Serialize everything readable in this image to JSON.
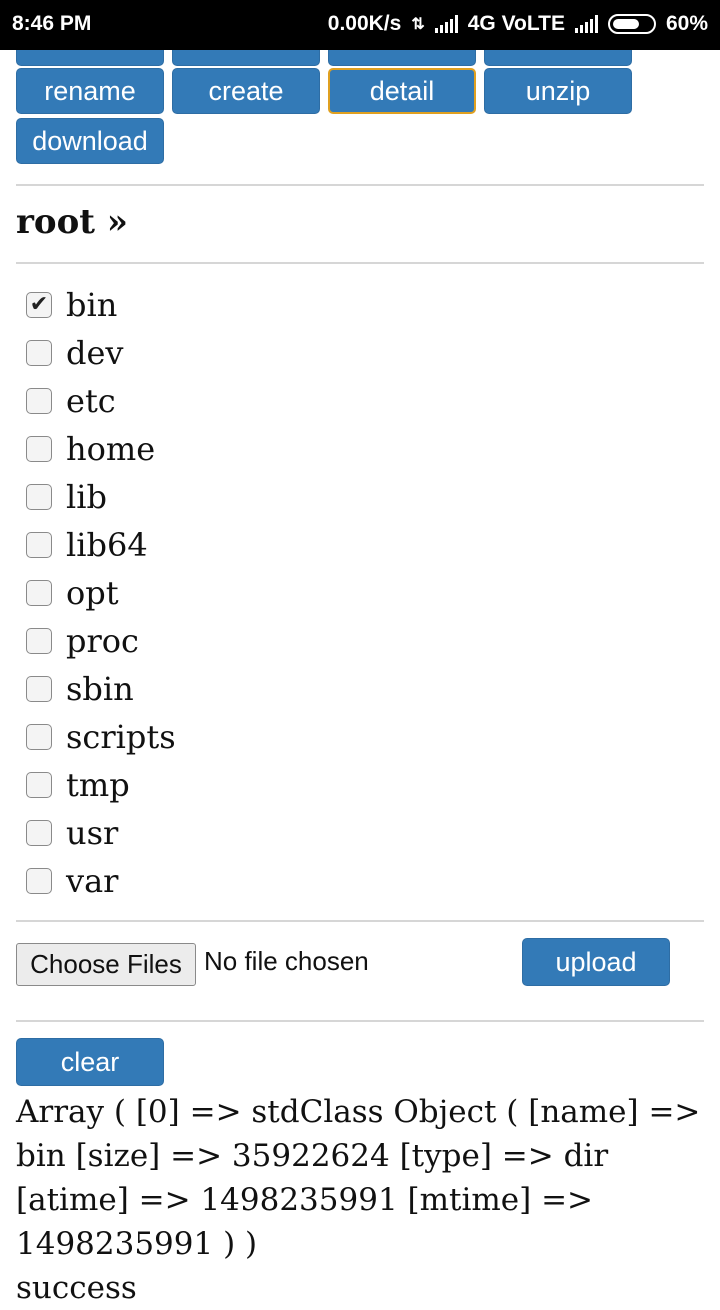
{
  "status_bar": {
    "time": "8:46 PM",
    "net_speed": "0.00K/s",
    "network": "4G VoLTE",
    "battery": "60%"
  },
  "toolbar": {
    "rename": "rename",
    "create": "create",
    "detail": "detail",
    "unzip": "unzip",
    "download": "download"
  },
  "breadcrumb": "root »",
  "files": [
    {
      "name": "bin",
      "checked": true
    },
    {
      "name": "dev",
      "checked": false
    },
    {
      "name": "etc",
      "checked": false
    },
    {
      "name": "home",
      "checked": false
    },
    {
      "name": "lib",
      "checked": false
    },
    {
      "name": "lib64",
      "checked": false
    },
    {
      "name": "opt",
      "checked": false
    },
    {
      "name": "proc",
      "checked": false
    },
    {
      "name": "sbin",
      "checked": false
    },
    {
      "name": "scripts",
      "checked": false
    },
    {
      "name": "tmp",
      "checked": false
    },
    {
      "name": "usr",
      "checked": false
    },
    {
      "name": "var",
      "checked": false
    }
  ],
  "upload": {
    "choose_label": "Choose Files",
    "no_file_text": "No file chosen",
    "upload_label": "upload"
  },
  "clear_label": "clear",
  "output_text": "Array ( [0] => stdClass Object ( [name] => bin [size] => 35922624 [type] => dir [atime] => 1498235991 [mtime] => 1498235991 ) )",
  "result_text": "success"
}
